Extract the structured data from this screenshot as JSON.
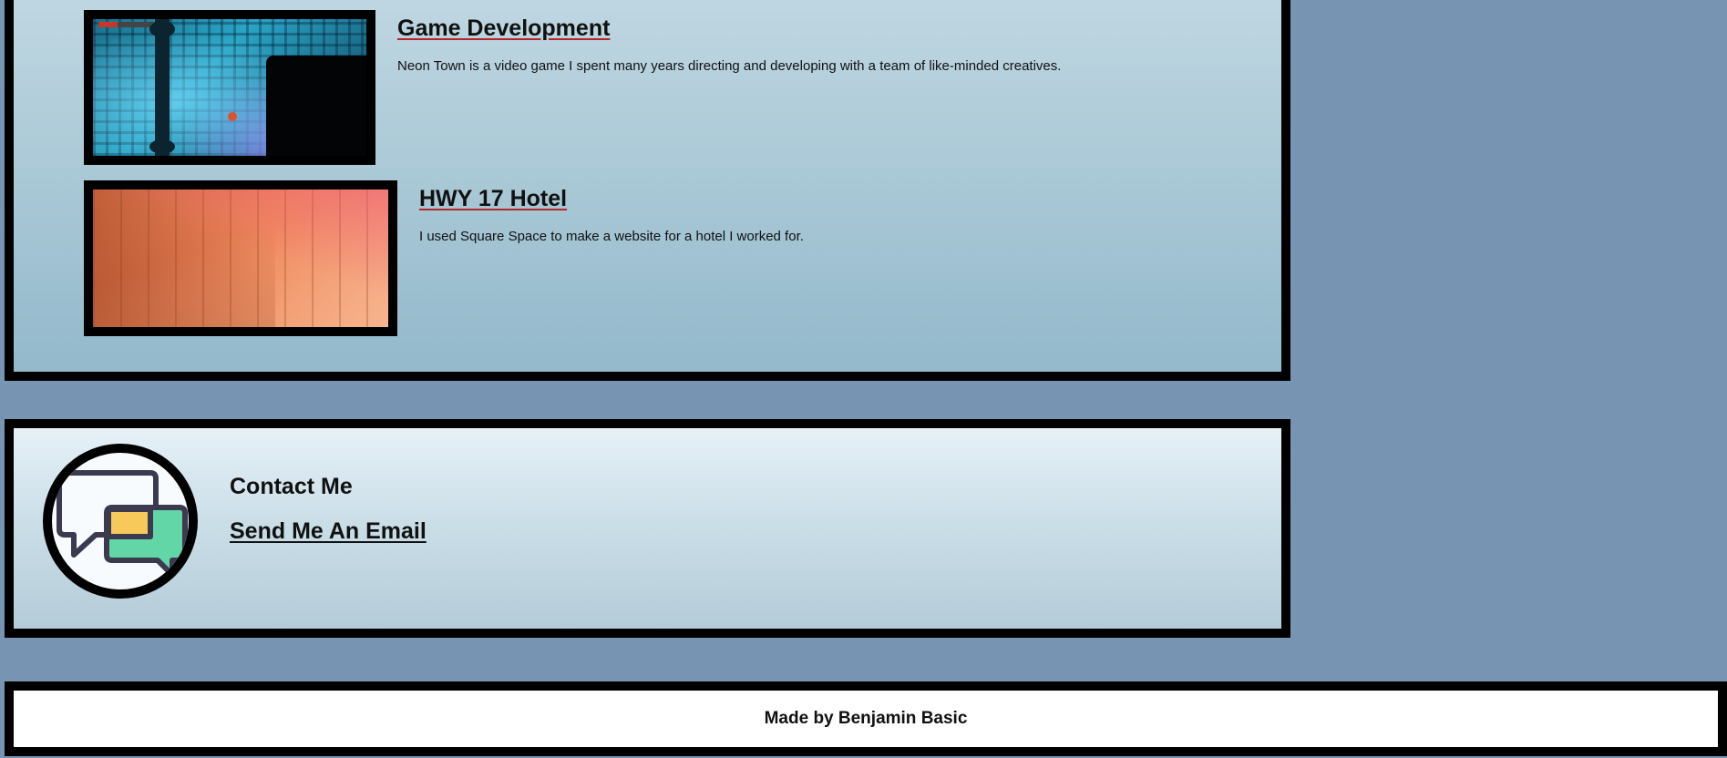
{
  "projects": [
    {
      "title": "Game Development",
      "description": "Neon Town is a video game I spent many years directing and developing with a team of like-minded creatives.",
      "thumbnail": "neon-town-screenshot"
    },
    {
      "title": "HWY 17 Hotel",
      "description": "I used Square Space to make a website for a hotel I worked for.",
      "thumbnail": "hotel-building-photo"
    }
  ],
  "contact": {
    "heading": "Contact Me",
    "email_link": "Send Me An Email",
    "icon": "chat-bubbles-icon"
  },
  "footer": {
    "text": "Made by Benjamin Basic"
  },
  "colors": {
    "page_background": "#7795b2",
    "border": "#000000",
    "title_underline": "#b3262c",
    "chat_bubble_yellow": "#f7c95a",
    "chat_bubble_green": "#63d6a8",
    "chat_bubble_outline": "#3b3a4f"
  }
}
